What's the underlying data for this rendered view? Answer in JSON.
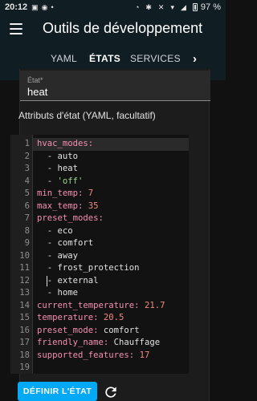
{
  "status_bar": {
    "time": "20:12",
    "battery_percent": "97 %"
  },
  "header": {
    "title": "Outils de développement",
    "tabs": [
      {
        "label": "YAML",
        "active": false
      },
      {
        "label": "ÉTATS",
        "active": true
      },
      {
        "label": "SERVICES",
        "active": false
      }
    ]
  },
  "state_field": {
    "label": "État*",
    "value": "heat"
  },
  "attributes_title": "Attributs d'état (YAML, facultatif)",
  "editor": {
    "lines": [
      {
        "n": "1",
        "parts": [
          {
            "t": "hvac_modes:",
            "c": "key"
          }
        ]
      },
      {
        "n": "2",
        "parts": [
          {
            "t": "  - ",
            "c": "dash"
          },
          {
            "t": "auto",
            "c": "val"
          }
        ]
      },
      {
        "n": "3",
        "parts": [
          {
            "t": "  - ",
            "c": "dash"
          },
          {
            "t": "heat",
            "c": "val"
          }
        ]
      },
      {
        "n": "4",
        "parts": [
          {
            "t": "  - ",
            "c": "dash"
          },
          {
            "t": "'off'",
            "c": "str"
          }
        ]
      },
      {
        "n": "5",
        "parts": [
          {
            "t": "min_temp: ",
            "c": "key"
          },
          {
            "t": "7",
            "c": "num"
          }
        ]
      },
      {
        "n": "6",
        "parts": [
          {
            "t": "max_temp: ",
            "c": "key"
          },
          {
            "t": "35",
            "c": "num"
          }
        ]
      },
      {
        "n": "7",
        "parts": [
          {
            "t": "preset_modes:",
            "c": "key"
          }
        ]
      },
      {
        "n": "8",
        "parts": [
          {
            "t": "  - ",
            "c": "dash"
          },
          {
            "t": "eco",
            "c": "val"
          }
        ]
      },
      {
        "n": "9",
        "parts": [
          {
            "t": "  - ",
            "c": "dash"
          },
          {
            "t": "comfort",
            "c": "val"
          }
        ]
      },
      {
        "n": "10",
        "parts": [
          {
            "t": "  - ",
            "c": "dash"
          },
          {
            "t": "away",
            "c": "val"
          }
        ]
      },
      {
        "n": "11",
        "parts": [
          {
            "t": "  - ",
            "c": "dash"
          },
          {
            "t": "frost_protection",
            "c": "val"
          }
        ]
      },
      {
        "n": "12",
        "parts": [
          {
            "t": "  - ",
            "c": "dash"
          },
          {
            "t": "external",
            "c": "val"
          }
        ]
      },
      {
        "n": "13",
        "parts": [
          {
            "t": "  - ",
            "c": "dash"
          },
          {
            "t": "home",
            "c": "val"
          }
        ]
      },
      {
        "n": "14",
        "parts": [
          {
            "t": "current_temperature: ",
            "c": "key"
          },
          {
            "t": "21.7",
            "c": "num"
          }
        ]
      },
      {
        "n": "15",
        "parts": [
          {
            "t": "temperature: ",
            "c": "key"
          },
          {
            "t": "20.5",
            "c": "num"
          }
        ]
      },
      {
        "n": "16",
        "parts": [
          {
            "t": "preset_mode: ",
            "c": "key"
          },
          {
            "t": "comfort",
            "c": "val"
          }
        ]
      },
      {
        "n": "17",
        "parts": [
          {
            "t": "friendly_name: ",
            "c": "key"
          },
          {
            "t": "Chauffage",
            "c": "val"
          }
        ]
      },
      {
        "n": "18",
        "parts": [
          {
            "t": "supported_features: ",
            "c": "key"
          },
          {
            "t": "17",
            "c": "num"
          }
        ]
      },
      {
        "n": "19",
        "parts": []
      }
    ]
  },
  "footer": {
    "set_state_label": "DÉFINIR L'ÉTAT"
  },
  "colors": {
    "header_bg": "#101e24",
    "accent": "#03a9f4",
    "yaml_key": "#f48fb1",
    "yaml_number": "#ef8a80",
    "yaml_string": "#9ed58f"
  },
  "icons": [
    "menu-icon",
    "chevron-right-icon",
    "refresh-icon",
    "wifi-icon",
    "bluetooth-icon",
    "alarm-icon",
    "mute-icon",
    "battery-icon"
  ]
}
